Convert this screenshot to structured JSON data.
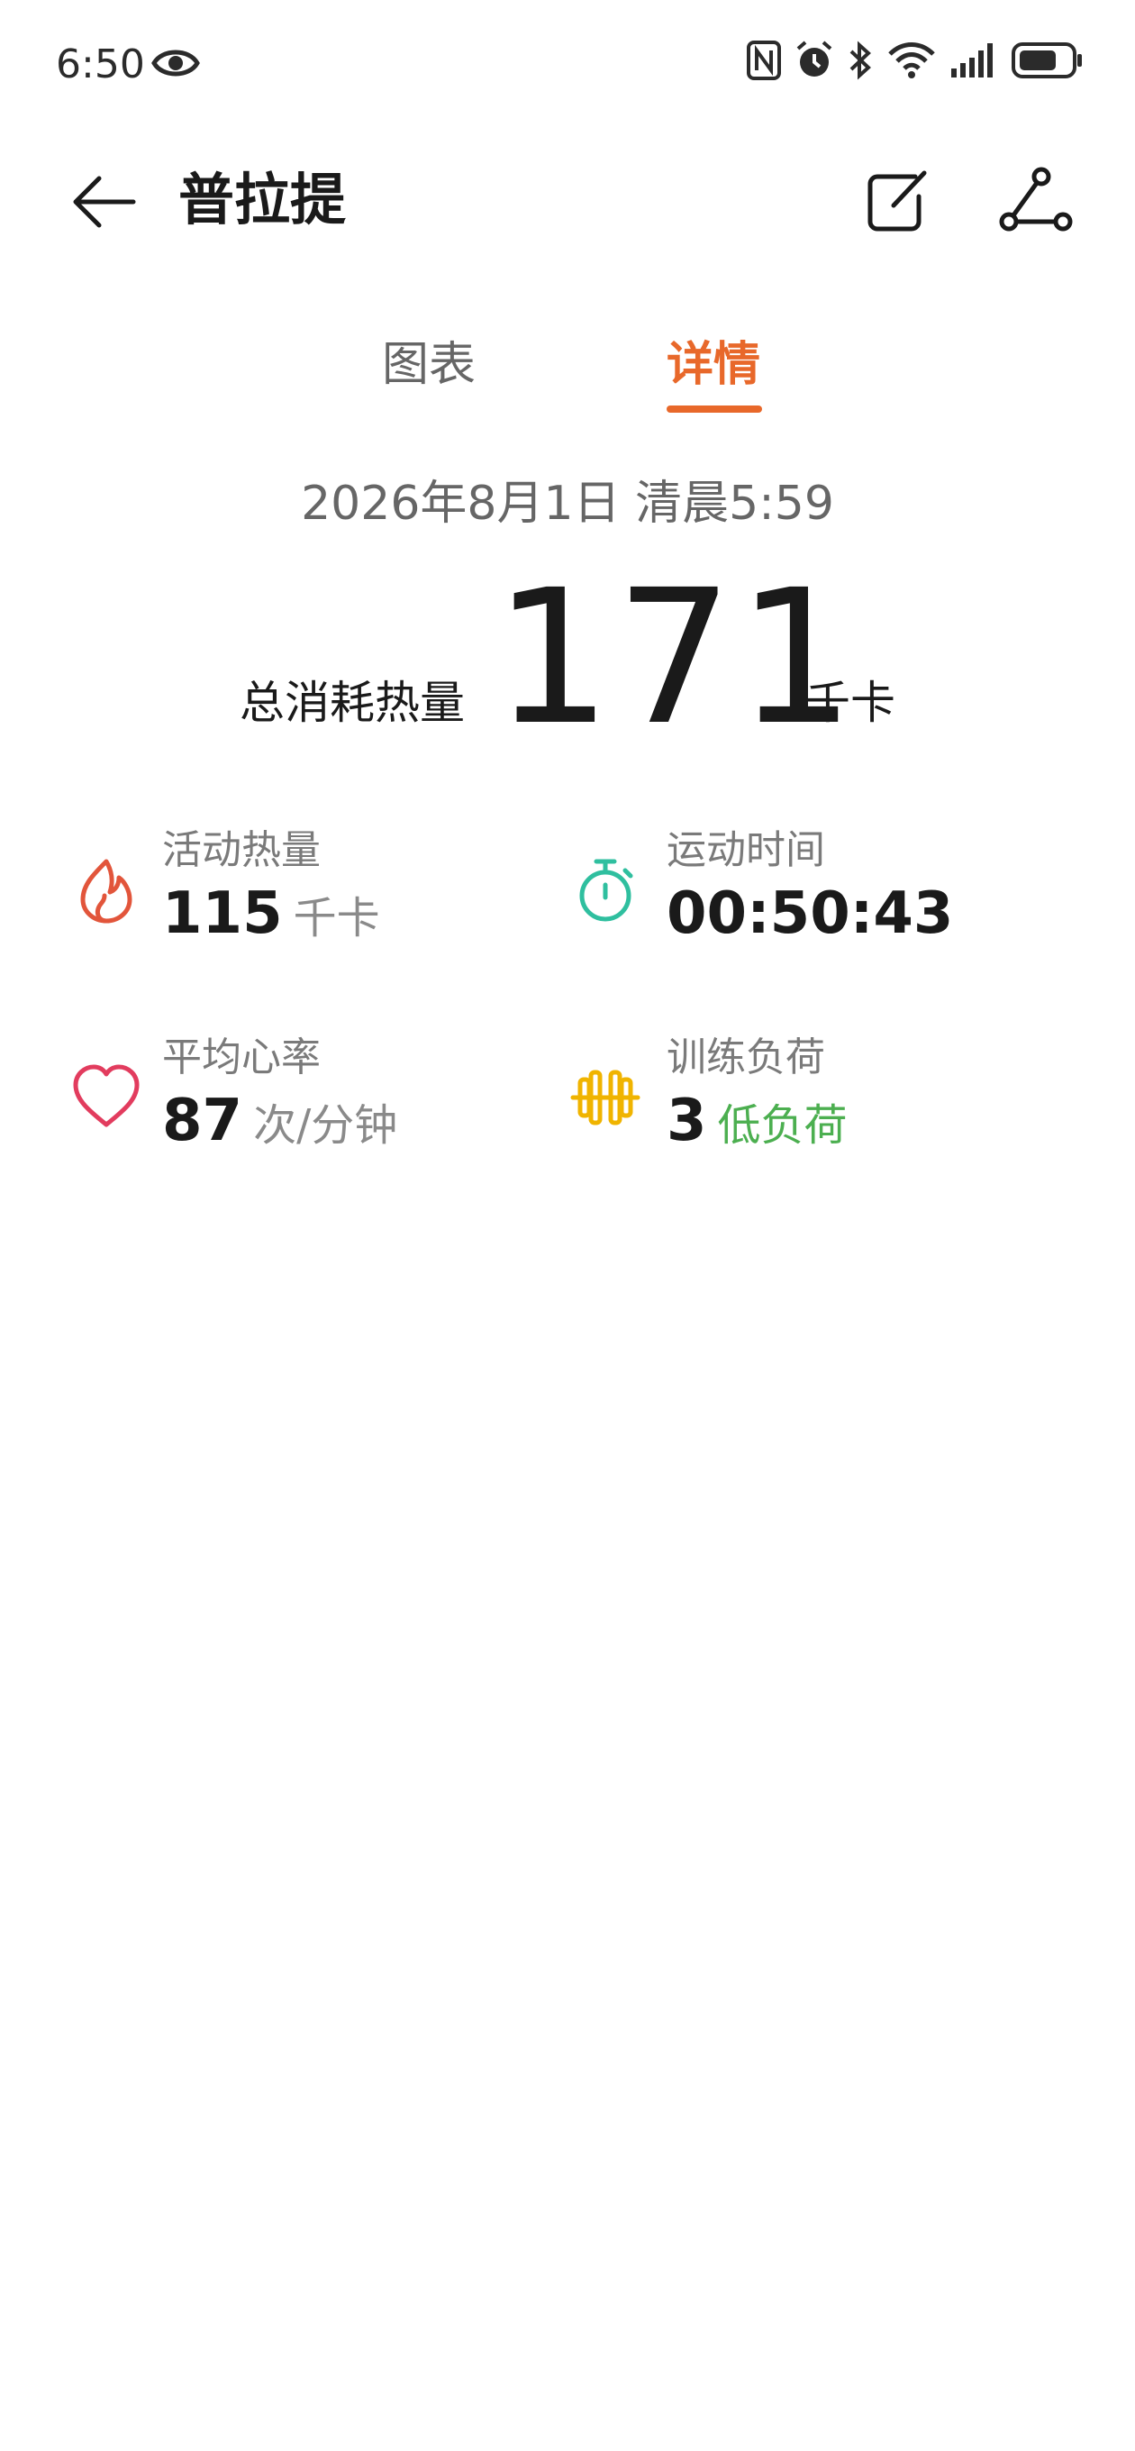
{
  "status_bar": {
    "time": "6:50",
    "icons": [
      "eye-icon",
      "nfc-icon",
      "alarm-icon",
      "bluetooth-icon",
      "wifi-icon",
      "signal-icon",
      "battery-icon"
    ]
  },
  "header": {
    "title": "普拉提",
    "icons": [
      "back-arrow-icon",
      "edit-icon",
      "route-icon"
    ]
  },
  "tabs": [
    {
      "label": "图表",
      "active": false
    },
    {
      "label": "详情",
      "active": true
    }
  ],
  "summary": {
    "datetime": "2026年8月1日 清晨5:59",
    "total_label": "总消耗热量",
    "total_value": "171",
    "total_unit": "千卡"
  },
  "stats": {
    "active_calories": {
      "label": "活动热量",
      "value": "115",
      "unit": "千卡",
      "icon": "flame-icon",
      "color": "#e2553b"
    },
    "workout_time": {
      "label": "运动时间",
      "value": "00:50:43",
      "icon": "stopwatch-icon",
      "color": "#2fbf9f"
    },
    "avg_heart_rate": {
      "label": "平均心率",
      "value": "87",
      "unit": "次/分钟",
      "icon": "heart-icon",
      "color": "#e23c5e"
    },
    "training_load": {
      "label": "训练负荷",
      "value": "3",
      "unit": "低负荷",
      "icon": "dumbbell-icon",
      "color": "#f0b400"
    }
  },
  "colors": {
    "accent": "#e8682a",
    "low_load": "#4caf50"
  }
}
